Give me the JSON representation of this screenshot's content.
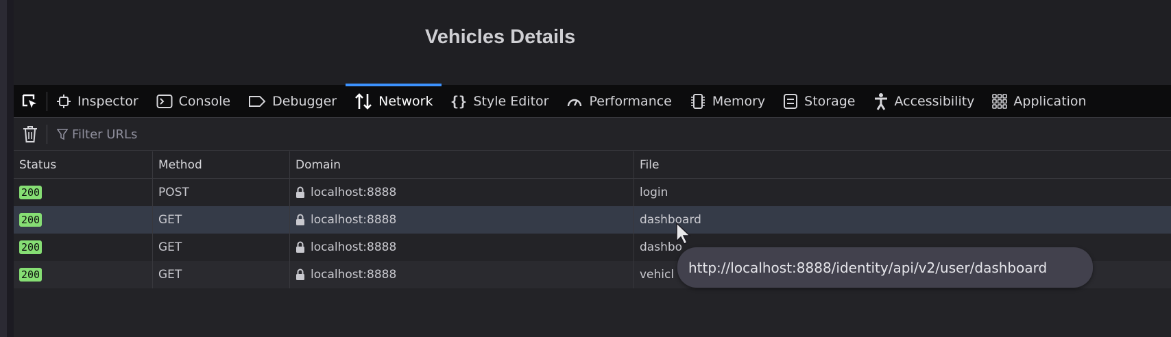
{
  "page": {
    "title": "Vehicles Details"
  },
  "devtools": {
    "tabs": [
      {
        "label": "Inspector",
        "icon": "inspector-icon"
      },
      {
        "label": "Console",
        "icon": "console-icon"
      },
      {
        "label": "Debugger",
        "icon": "debugger-icon"
      },
      {
        "label": "Network",
        "icon": "network-icon",
        "active": true
      },
      {
        "label": "Style Editor",
        "icon": "style-editor-icon"
      },
      {
        "label": "Performance",
        "icon": "performance-icon"
      },
      {
        "label": "Memory",
        "icon": "memory-icon"
      },
      {
        "label": "Storage",
        "icon": "storage-icon"
      },
      {
        "label": "Accessibility",
        "icon": "accessibility-icon"
      },
      {
        "label": "Application",
        "icon": "application-icon"
      }
    ],
    "toolbar": {
      "filter_placeholder": "Filter URLs"
    },
    "table": {
      "headers": {
        "status": "Status",
        "method": "Method",
        "domain": "Domain",
        "file": "File"
      },
      "rows": [
        {
          "status": "200",
          "method": "POST",
          "domain": "localhost:8888",
          "file": "login"
        },
        {
          "status": "200",
          "method": "GET",
          "domain": "localhost:8888",
          "file": "dashboard"
        },
        {
          "status": "200",
          "method": "GET",
          "domain": "localhost:8888",
          "file": "dashbo"
        },
        {
          "status": "200",
          "method": "GET",
          "domain": "localhost:8888",
          "file": "vehicl"
        }
      ]
    },
    "tooltip": "http://localhost:8888/identity/api/v2/user/dashboard"
  },
  "colors": {
    "accent": "#3c92ff",
    "status_ok": "#86de74",
    "hover_row": "#353b48"
  }
}
